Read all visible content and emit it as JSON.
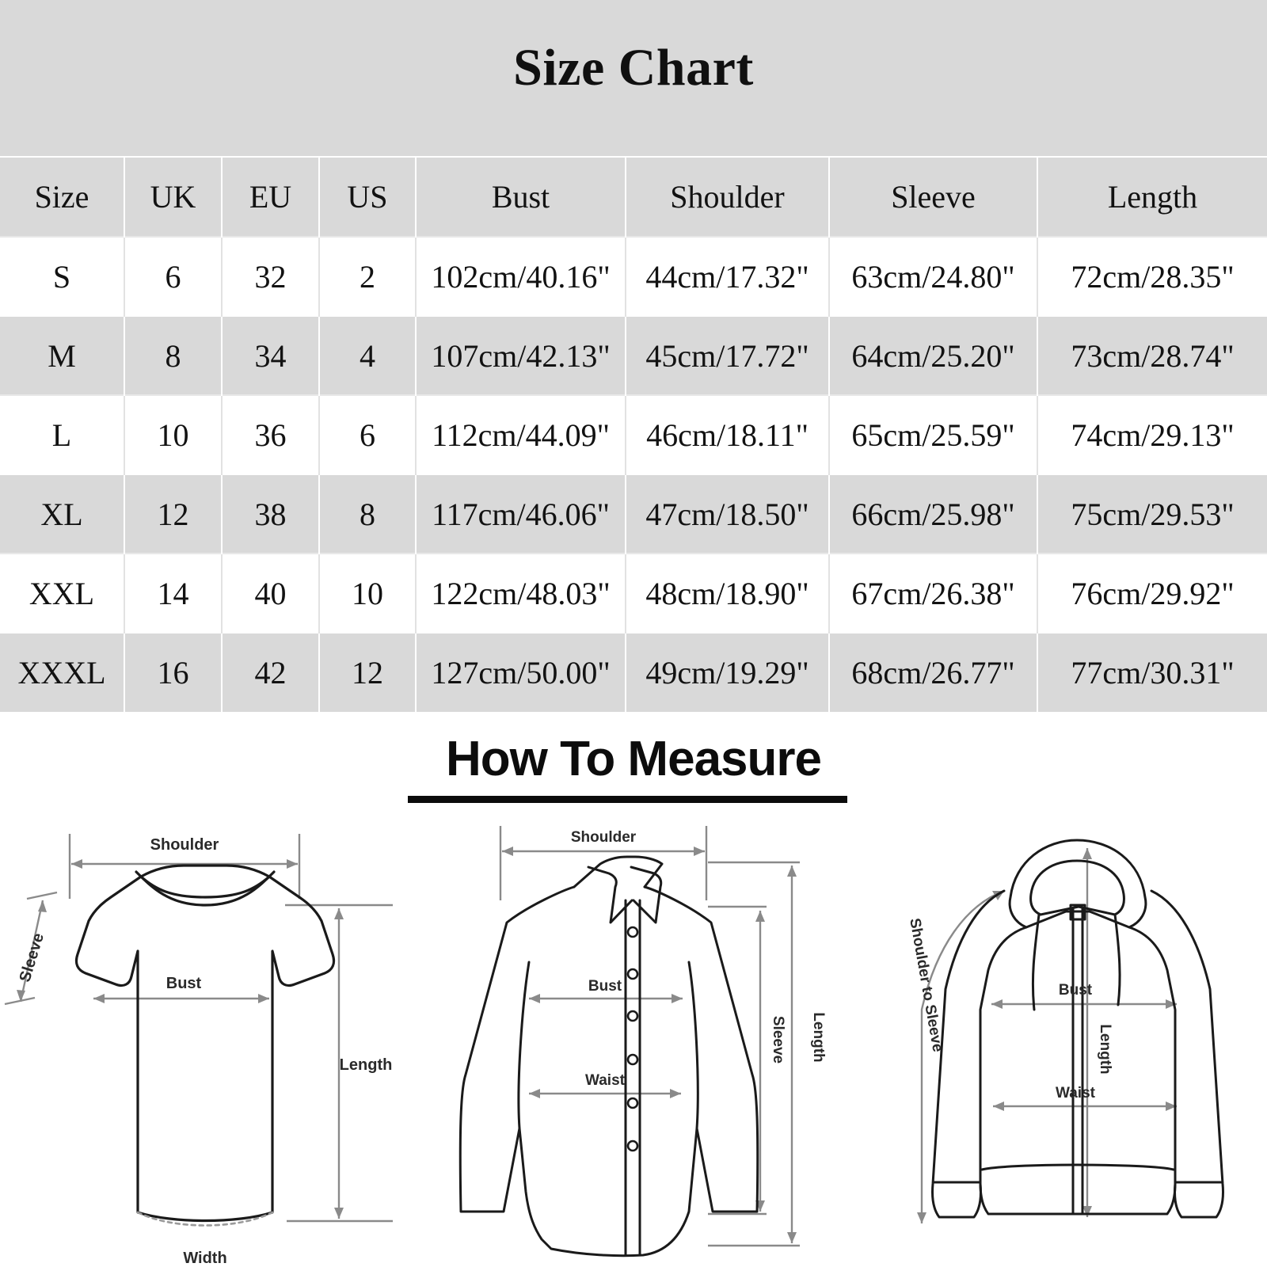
{
  "title": "Size Chart",
  "colors": {
    "header_band": "#d9d9d9",
    "row_alt": "#d9d9d9",
    "row_base": "#ffffff",
    "text": "#121212",
    "diagram_line": "#1a1a1a",
    "diagram_dim_line": "#8a8a8a"
  },
  "table": {
    "columns": [
      "Size",
      "UK",
      "EU",
      "US",
      "Bust",
      "Shoulder",
      "Sleeve",
      "Length"
    ],
    "rows": [
      {
        "size": "S",
        "uk": "6",
        "eu": "32",
        "us": "2",
        "bust": "102cm/40.16\"",
        "shoulder": "44cm/17.32\"",
        "sleeve": "63cm/24.80\"",
        "length": "72cm/28.35\""
      },
      {
        "size": "M",
        "uk": "8",
        "eu": "34",
        "us": "4",
        "bust": "107cm/42.13\"",
        "shoulder": "45cm/17.72\"",
        "sleeve": "64cm/25.20\"",
        "length": "73cm/28.74\""
      },
      {
        "size": "L",
        "uk": "10",
        "eu": "36",
        "us": "6",
        "bust": "112cm/44.09\"",
        "shoulder": "46cm/18.11\"",
        "sleeve": "65cm/25.59\"",
        "length": "74cm/29.13\""
      },
      {
        "size": "XL",
        "uk": "12",
        "eu": "38",
        "us": "8",
        "bust": "117cm/46.06\"",
        "shoulder": "47cm/18.50\"",
        "sleeve": "66cm/25.98\"",
        "length": "75cm/29.53\""
      },
      {
        "size": "XXL",
        "uk": "14",
        "eu": "40",
        "us": "10",
        "bust": "122cm/48.03\"",
        "shoulder": "48cm/18.90\"",
        "sleeve": "67cm/26.38\"",
        "length": "76cm/29.92\""
      },
      {
        "size": "XXXL",
        "uk": "16",
        "eu": "42",
        "us": "12",
        "bust": "127cm/50.00\"",
        "shoulder": "49cm/19.29\"",
        "sleeve": "68cm/26.77\"",
        "length": "77cm/30.31\""
      }
    ]
  },
  "how_to_measure": {
    "heading": "How To Measure",
    "figures": [
      {
        "garment": "t-shirt",
        "labels": {
          "shoulder": "Shoulder",
          "sleeve": "Sleeve",
          "bust": "Bust",
          "length": "Length",
          "width": "Width"
        }
      },
      {
        "garment": "button-shirt",
        "labels": {
          "shoulder": "Shoulder",
          "bust": "Bust",
          "waist": "Waist",
          "sleeve": "Sleeve",
          "length": "Length"
        }
      },
      {
        "garment": "zip-hoodie",
        "labels": {
          "shoulder_to_sleeve": "Shoulder to Sleeve",
          "bust": "Bust",
          "length": "Length",
          "waist": "Waist"
        }
      }
    ]
  }
}
